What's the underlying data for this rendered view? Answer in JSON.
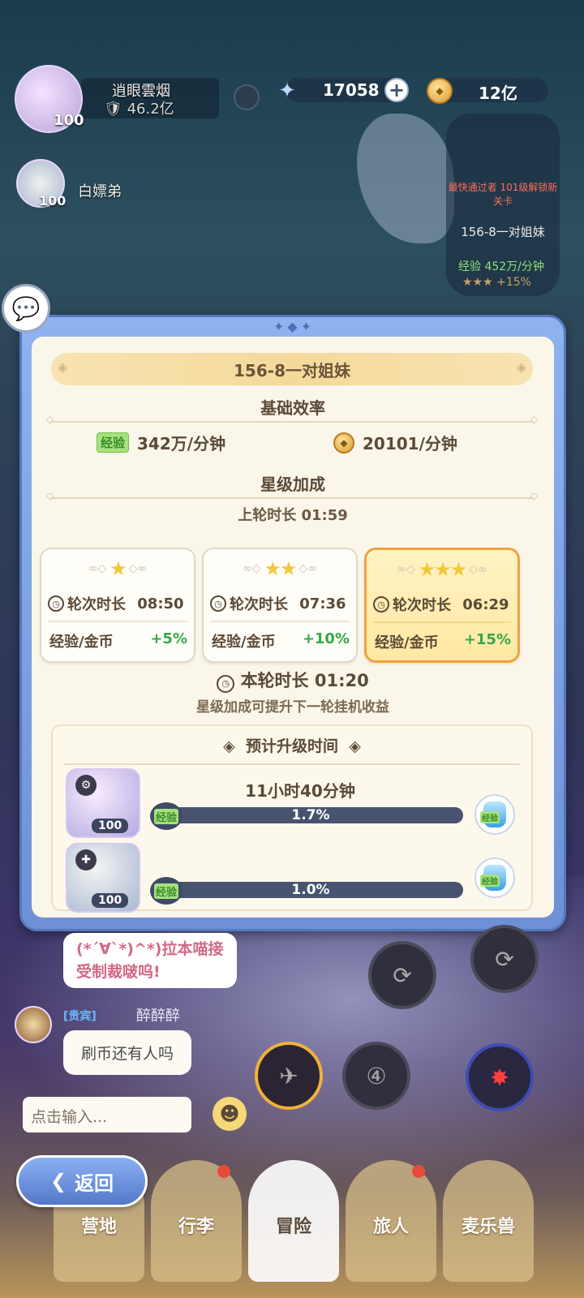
{
  "hud": {
    "players": [
      {
        "name": "逍眼雲烟",
        "power": "46.2亿",
        "level": "100"
      },
      {
        "name": "白嫖弟",
        "level": "100"
      }
    ],
    "gems": "17058",
    "gold": "12亿",
    "stage_card": {
      "note": "最快通过者 101级解锁新关卡",
      "stage": "156-8一对姐妹",
      "exp_label": "经验",
      "exp_rate": "452万/分钟",
      "stars": "★★★",
      "bonus": "+15%"
    }
  },
  "modal": {
    "stage_title": "156-8一对姐妹",
    "base_title": "基础效率",
    "exp_tag": "经验",
    "exp_rate": "342万/分钟",
    "gold_rate": "20101/分钟",
    "star_title": "星级加成",
    "last_round_label": "上轮时长",
    "last_round_time": "01:59",
    "tiers": [
      {
        "stars": "★",
        "round_label": "轮次时长",
        "round_time": "08:50",
        "bonus_label": "经验/金币",
        "bonus": "+5%",
        "active": false
      },
      {
        "stars": "★★",
        "round_label": "轮次时长",
        "round_time": "07:36",
        "bonus_label": "经验/金币",
        "bonus": "+10%",
        "active": false
      },
      {
        "stars": "★★★",
        "round_label": "轮次时长",
        "round_time": "06:29",
        "bonus_label": "经验/金币",
        "bonus": "+15%",
        "active": true
      }
    ],
    "current_round_label": "本轮时长",
    "current_round_time": "01:20",
    "tip": "星级加成可提升下一轮挂机收益",
    "upgrade_title": "预计升级时间",
    "heroes": [
      {
        "level": "100",
        "eta": "11小时40分钟",
        "exp_label": "经验",
        "progress_text": "1.7%",
        "progress": 0.017,
        "potion_label": "经验"
      },
      {
        "level": "100",
        "eta": "",
        "exp_label": "经验",
        "progress_text": "1.0%",
        "progress": 0.01,
        "potion_label": "经验"
      }
    ]
  },
  "chat": {
    "bubble1": "(*´∀`*)^*)拉本喵接受制裁啵呜!",
    "vip": "[贵宾]",
    "user": "醉醉醉",
    "bubble2": "刷币还有人吗",
    "input_placeholder": "点击输入..."
  },
  "nav": {
    "back": "返回",
    "tabs": [
      "营地",
      "行李",
      "冒险",
      "旅人",
      "麦乐兽"
    ],
    "active_tab": "冒险"
  },
  "colors": {
    "modal_frame": "#6e90d6",
    "panel_bg": "#fbf6ea",
    "active_card_border": "#f0a23f",
    "bonus_green": "#35a84a",
    "progress_bar": "#47536f"
  }
}
